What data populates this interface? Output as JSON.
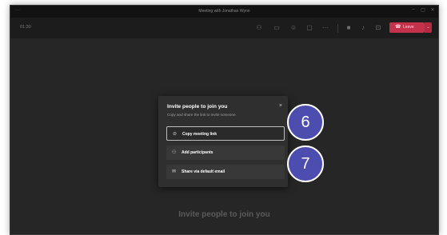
{
  "window": {
    "title": "Meeting with Jonathan Wynn",
    "controls": {
      "minimize": "–",
      "maximize": "▢",
      "close": "✕"
    }
  },
  "toolbar": {
    "timer": "01:30",
    "icons": [
      "participants-icon",
      "chat-icon",
      "reactions-icon",
      "share-tray-icon",
      "more-actions-icon",
      "camera-icon",
      "microphone-icon",
      "share-screen-icon"
    ],
    "more_glyph": "···",
    "leave_label": "Leave",
    "leave_caret": "⌄",
    "leave_color": "#c4314b"
  },
  "dialog": {
    "title": "Invite people to join you",
    "subtitle": "Copy and share the link to invite someone.",
    "close": "×",
    "options": [
      {
        "label": "Copy meeting link",
        "icon": "link-icon",
        "glyph": "⊘",
        "selected": true
      },
      {
        "label": "Add participants",
        "icon": "add-person-icon",
        "glyph": "⚇",
        "selected": false
      },
      {
        "label": "Share via default email",
        "icon": "mail-icon",
        "glyph": "✉",
        "selected": false
      }
    ]
  },
  "badges": [
    {
      "number": "6",
      "color": "#4c4dae"
    },
    {
      "number": "7",
      "color": "#4c4dae"
    }
  ],
  "stage": {
    "caption": "Invite people to join you"
  }
}
